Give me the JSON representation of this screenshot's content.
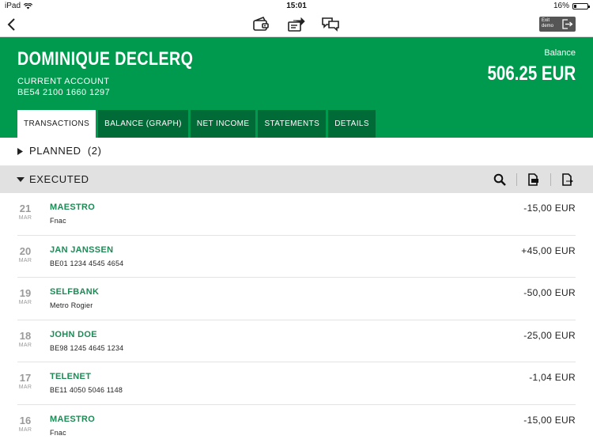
{
  "status_bar": {
    "device": "iPad",
    "time": "15:01",
    "battery_text": "16%",
    "battery_level": 0.16
  },
  "navbar": {
    "exit_demo_line1": "Exit",
    "exit_demo_line2": "demo"
  },
  "account": {
    "holder": "DOMINIQUE DECLERQ",
    "type": "CURRENT ACCOUNT",
    "iban": "BE54 2100 1660 1297",
    "balance_label": "Balance",
    "balance_value": "506.25 EUR"
  },
  "tabs": [
    {
      "label": "TRANSACTIONS",
      "active": true
    },
    {
      "label": "BALANCE (GRAPH)",
      "active": false
    },
    {
      "label": "NET INCOME",
      "active": false
    },
    {
      "label": "STATEMENTS",
      "active": false
    },
    {
      "label": "DETAILS",
      "active": false
    }
  ],
  "planned": {
    "label": "PLANNED",
    "count": "(2)"
  },
  "executed": {
    "label": "EXECUTED"
  },
  "transactions": [
    {
      "day": "21",
      "month": "MAR",
      "name": "MAESTRO",
      "description": "Fnac",
      "amount": "-15,00 EUR"
    },
    {
      "day": "20",
      "month": "MAR",
      "name": "JAN JANSSEN",
      "description": "BE01 1234 4545 4654",
      "amount": "+45,00 EUR"
    },
    {
      "day": "19",
      "month": "MAR",
      "name": "SELFBANK",
      "description": "Metro Rogier",
      "amount": "-50,00 EUR"
    },
    {
      "day": "18",
      "month": "MAR",
      "name": "JOHN DOE",
      "description": "BE98 1245 4645 1234",
      "amount": "-25,00 EUR"
    },
    {
      "day": "17",
      "month": "MAR",
      "name": "TELENET",
      "description": "BE11 4050 5046 1148",
      "amount": "-1,04 EUR"
    },
    {
      "day": "16",
      "month": "MAR",
      "name": "MAESTRO",
      "description": "Fnac",
      "amount": "-15,00 EUR"
    }
  ],
  "icons": {
    "back": "chevron-left-icon",
    "wallet": "wallet-icon",
    "transfer": "transfer-icon",
    "chat": "chat-icon",
    "exit": "exit-icon",
    "search": "search-icon",
    "export_doc": "document-export-icon",
    "export_doc_2": "document-share-icon"
  },
  "colors": {
    "brand_green": "#009a4e",
    "tab_dark_green": "#006b36",
    "name_green": "#1e8a56",
    "executed_bar": "#e1e1e1"
  }
}
